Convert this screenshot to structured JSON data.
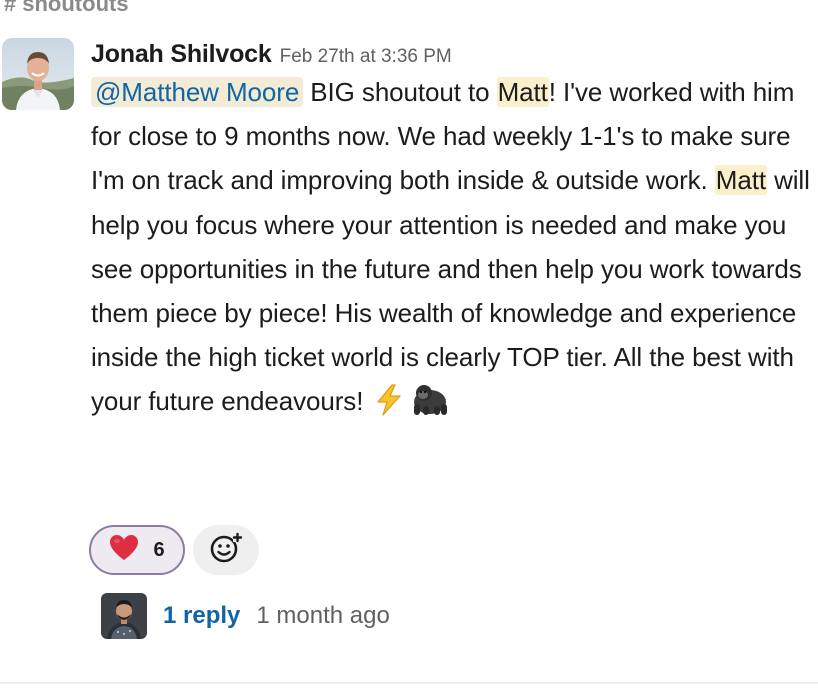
{
  "channel": {
    "hash": "#",
    "name": "shoutouts"
  },
  "message": {
    "author": "Jonah Shilvock",
    "timestamp": "Feb 27th at 3:36 PM",
    "mention": "@Matthew Moore",
    "text_1": " BIG shoutout to ",
    "highlight_1": "Matt",
    "text_2": "! I've worked with him for close to 9 months now. We had weekly 1-1's to make sure I'm on track and improving both inside & outside work. ",
    "highlight_2": "Matt",
    "text_3": " will help you focus where your attention is needed and make you see opportunities in the future and then help you work towards them piece by piece!  His wealth of knowledge and experience inside the high ticket world is clearly TOP tier. All the best with your future endeavours!",
    "emoji_1": "lightning-icon",
    "emoji_2": "gorilla-icon"
  },
  "reactions": [
    {
      "emoji": "heart-icon",
      "count": "6"
    },
    {
      "emoji": "add-reaction-icon"
    }
  ],
  "thread": {
    "reply_link": "1 reply",
    "reply_time": "1 month ago"
  },
  "colors": {
    "link_blue": "#1264a3",
    "mention_bg": "#f2ecd6",
    "highlight_bg": "#fbefcc",
    "timestamp_gray": "#616061"
  }
}
